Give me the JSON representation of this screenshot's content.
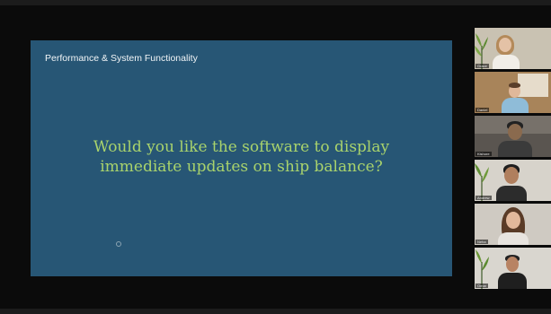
{
  "slide": {
    "section_title": "Performance & System Functionality",
    "question_line1": "Would you like the software to display",
    "question_line2": "immediate updates on ship balance?",
    "background": "#275675",
    "title_color": "#f2f5f7",
    "question_color": "#a9d36c"
  },
  "participants": [
    {
      "name": "Grace"
    },
    {
      "name": "Daniel"
    },
    {
      "name": "Kishore"
    },
    {
      "name": "Andrew"
    },
    {
      "name": "Neha"
    },
    {
      "name": "Omar"
    }
  ]
}
